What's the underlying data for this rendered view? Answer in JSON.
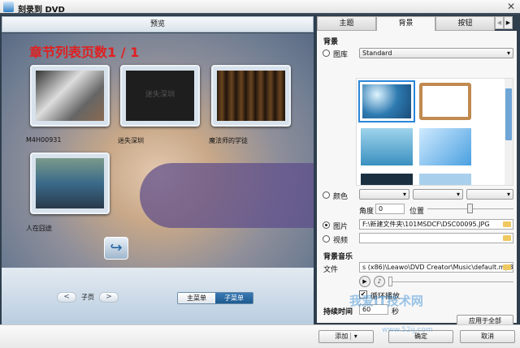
{
  "window": {
    "title": "刻录到 DVD",
    "close": "✕"
  },
  "preview": {
    "header": "预览",
    "chapter_title": "章节列表页数1 / 1",
    "chapters": [
      {
        "label": "M4H00931",
        "overlay": ""
      },
      {
        "label": "迷失深圳",
        "overlay": "迷失深圳"
      },
      {
        "label": "魔法师的学徒",
        "overlay": ""
      },
      {
        "label": "人在囧途",
        "overlay": ""
      }
    ],
    "return_icon": "↪"
  },
  "nav": {
    "prev": "<",
    "page_label": "子页",
    "next": ">",
    "main_menu": "主菜单",
    "sub_menu": "子菜单",
    "active": "子菜单"
  },
  "tabs": {
    "items": [
      "主题",
      "背景",
      "按钮"
    ],
    "active": "背景",
    "scroll_left": "◀",
    "scroll_right": "▶"
  },
  "background": {
    "section_label": "背景",
    "library_label": "图库",
    "library_value": "Standard",
    "color_label": "颜色",
    "angle_label": "角度",
    "angle_value": "0",
    "position_label": "位置",
    "position_value": 0.5,
    "image_label": "图片",
    "image_path": "F:\\新建文件夹\\101MSDCF\\DSC00095.JPG",
    "video_label": "视频",
    "video_path": "",
    "selected_source": "图片"
  },
  "music": {
    "section_label": "背景音乐",
    "file_label": "文件",
    "file_path": "s (x86)\\Leawo\\DVD Creator\\Music\\default.mp3",
    "loop_label": "循环播放",
    "loop_checked": true
  },
  "duration": {
    "label": "持续时间",
    "value": "60",
    "unit": "秒"
  },
  "apply_all": "应用于全部",
  "footer": {
    "add": "添加",
    "ok": "确定",
    "cancel": "取消"
  },
  "watermark": {
    "text": "我爱IT技术网",
    "url": "www.52ij.com"
  }
}
